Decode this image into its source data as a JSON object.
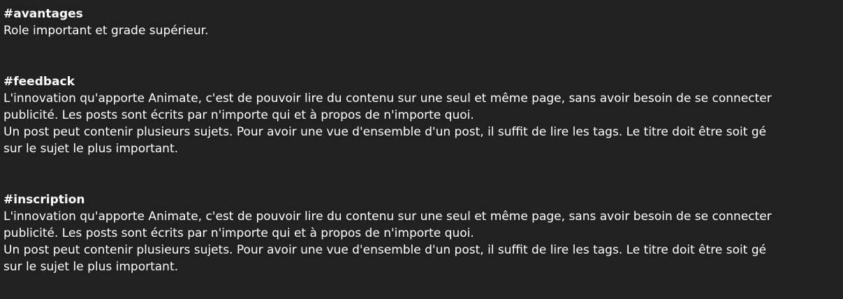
{
  "sections": [
    {
      "tag": "#avantages",
      "lines": [
        "Role important et grade supérieur."
      ]
    },
    {
      "tag": "#feedback",
      "lines": [
        "L'innovation qu'apporte Animate, c'est de pouvoir lire du contenu sur une seul et même page, sans avoir besoin de se connecter",
        "publicité. Les posts sont écrits par n'importe qui et à propos de n'importe quoi.",
        "Un post peut contenir plusieurs sujets. Pour avoir une vue d'ensemble d'un post, il suffit de lire les tags. Le titre doit être soit gé",
        "sur le sujet le plus important."
      ]
    },
    {
      "tag": "#inscription",
      "lines": [
        "L'innovation qu'apporte Animate, c'est de pouvoir lire du contenu sur une seul et même page, sans avoir besoin de se connecter",
        "publicité. Les posts sont écrits par n'importe qui et à propos de n'importe quoi.",
        "Un post peut contenir plusieurs sujets. Pour avoir une vue d'ensemble d'un post, il suffit de lire les tags. Le titre doit être soit gé",
        "sur le sujet le plus important."
      ]
    }
  ]
}
